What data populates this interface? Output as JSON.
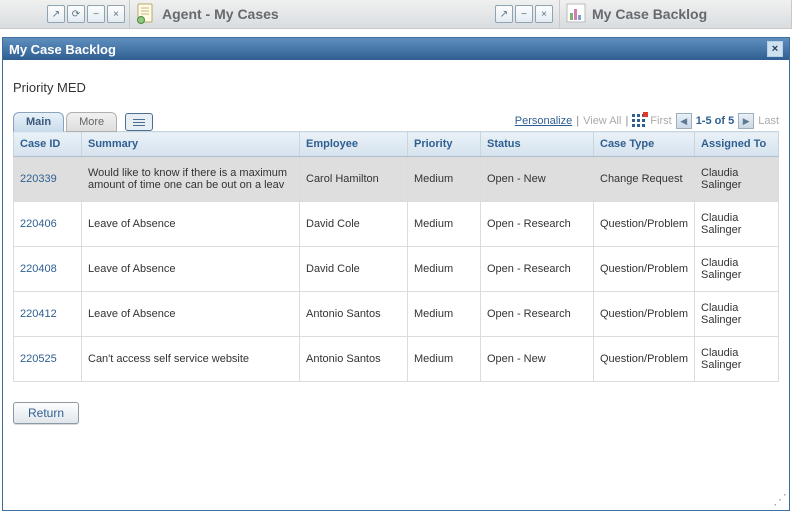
{
  "top_header": {
    "panel1_title": "Agent - My Cases",
    "panel2_title": "My Case Backlog"
  },
  "pagelet": {
    "title": "My Case Backlog",
    "subtitle": "Priority MED"
  },
  "tabs": {
    "main": "Main",
    "more": "More"
  },
  "toolbar": {
    "personalize": "Personalize",
    "view_all": "View All",
    "first": "First",
    "last": "Last",
    "range": "1-5 of 5"
  },
  "columns": {
    "case_id": "Case ID",
    "summary": "Summary",
    "employee": "Employee",
    "priority": "Priority",
    "status": "Status",
    "case_type": "Case Type",
    "assigned_to": "Assigned To"
  },
  "rows": [
    {
      "case_id": "220339",
      "summary": "Would like to know if there is a maximum amount of time one can be out on a leav",
      "employee": "Carol Hamilton",
      "priority": "Medium",
      "status": "Open - New",
      "case_type": "Change Request",
      "assigned_to": "Claudia Salinger"
    },
    {
      "case_id": "220406",
      "summary": "Leave of Absence",
      "employee": "David Cole",
      "priority": "Medium",
      "status": "Open - Research",
      "case_type": "Question/Problem",
      "assigned_to": "Claudia Salinger"
    },
    {
      "case_id": "220408",
      "summary": "Leave of Absence",
      "employee": "David Cole",
      "priority": "Medium",
      "status": "Open - Research",
      "case_type": "Question/Problem",
      "assigned_to": "Claudia Salinger"
    },
    {
      "case_id": "220412",
      "summary": "Leave of Absence",
      "employee": "Antonio Santos",
      "priority": "Medium",
      "status": "Open - Research",
      "case_type": "Question/Problem",
      "assigned_to": "Claudia Salinger"
    },
    {
      "case_id": "220525",
      "summary": "Can't access self service website",
      "employee": "Antonio Santos",
      "priority": "Medium",
      "status": "Open - New",
      "case_type": "Question/Problem",
      "assigned_to": "Claudia Salinger"
    }
  ],
  "buttons": {
    "return": "Return"
  }
}
